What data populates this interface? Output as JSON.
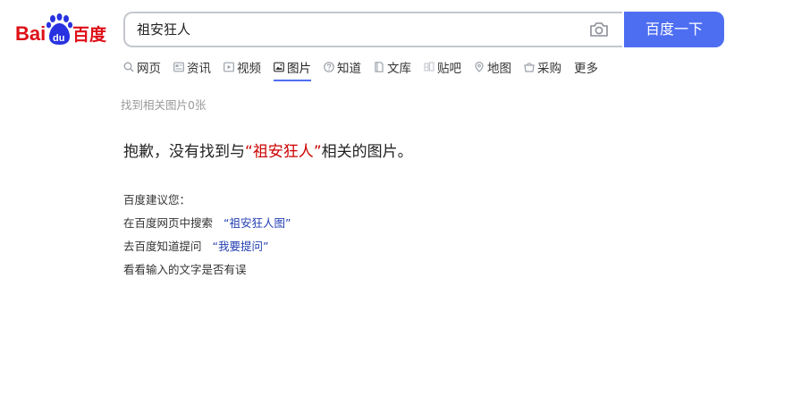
{
  "logo": {
    "text_left": "Bai",
    "text_mid": "du",
    "text_right": "百度"
  },
  "search": {
    "query": "祖安狂人",
    "button_label": "百度一下"
  },
  "tabs": [
    {
      "label": "网页",
      "icon": "search-icon",
      "active": false
    },
    {
      "label": "资讯",
      "icon": "news-icon",
      "active": false
    },
    {
      "label": "视频",
      "icon": "video-icon",
      "active": false
    },
    {
      "label": "图片",
      "icon": "image-icon",
      "active": true
    },
    {
      "label": "知道",
      "icon": "question-icon",
      "active": false
    },
    {
      "label": "文库",
      "icon": "document-icon",
      "active": false
    },
    {
      "label": "贴吧",
      "icon": "tieba-icon",
      "active": false
    },
    {
      "label": "地图",
      "icon": "map-icon",
      "active": false
    },
    {
      "label": "采购",
      "icon": "basket-icon",
      "active": false
    },
    {
      "label": "更多",
      "icon": "",
      "active": false
    }
  ],
  "results": {
    "count_text": "找到相关图片0张"
  },
  "apology": {
    "prefix": "抱歉，没有找到与",
    "open_quote": "“",
    "query": "祖安狂人",
    "close_quote": "”",
    "suffix": "相关的图片。"
  },
  "suggestions": {
    "title": "百度建议您：",
    "web_prefix": "在百度网页中搜索",
    "web_link": "“祖安狂人图”",
    "zhidao_prefix": "去百度知道提问",
    "zhidao_link": "“我要提问”",
    "check_text": "看看输入的文字是否有误"
  },
  "colors": {
    "accent": "#4e6ef2",
    "logo_red": "#de0f17",
    "logo_blue": "#2932e1",
    "query_red": "#cc0000",
    "link_blue": "#2440b3"
  }
}
